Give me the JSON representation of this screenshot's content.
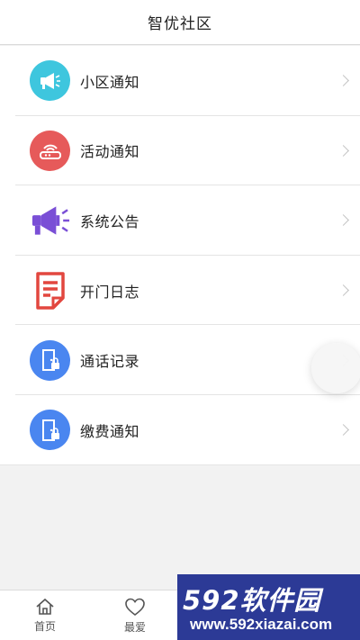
{
  "header": {
    "title": "智优社区"
  },
  "menu": [
    {
      "label": "小区通知",
      "icon": "megaphone-icon",
      "color": "#3ec6de"
    },
    {
      "label": "活动通知",
      "icon": "router-signal-icon",
      "color": "#e65a5a"
    },
    {
      "label": "系统公告",
      "icon": "loudspeaker-icon",
      "color": "#7a4fd6"
    },
    {
      "label": "开门日志",
      "icon": "document-icon",
      "color": "#e2473f"
    },
    {
      "label": "通话记录",
      "icon": "door-lock-icon",
      "color": "#4a86f0"
    },
    {
      "label": "缴费通知",
      "icon": "door-lock-icon",
      "color": "#4a86f0"
    }
  ],
  "tabs": [
    {
      "label": "首页",
      "icon": "home-icon"
    },
    {
      "label": "最爱",
      "icon": "heart-icon"
    }
  ],
  "watermark": {
    "big": "592软件园",
    "small": "www.592xiazai.com"
  }
}
